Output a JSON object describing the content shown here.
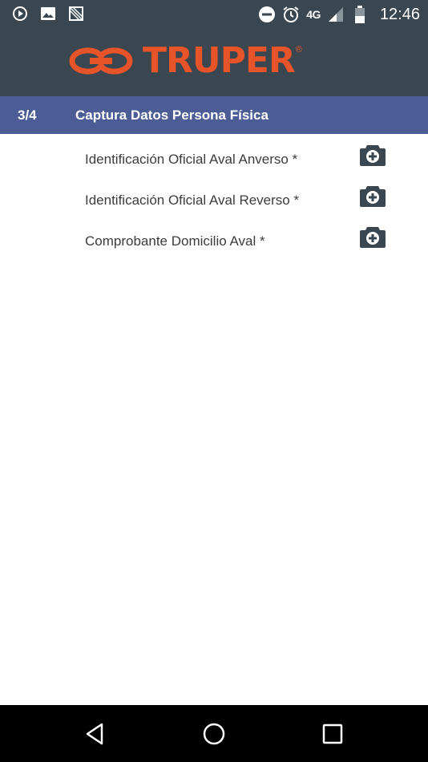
{
  "status_bar": {
    "left_icons": [
      "play-store-icon",
      "image-icon",
      "no-signal-icon"
    ],
    "network": "4G",
    "time": "12:46"
  },
  "header": {
    "brand": "TRUPER",
    "brand_mark": "®",
    "brand_color": "#e8542a"
  },
  "step": {
    "counter": "3/4",
    "title": "Captura Datos Persona Física"
  },
  "documents": [
    {
      "label": "Identificación Oficial Aval Anverso *",
      "action_icon": "camera-add-icon"
    },
    {
      "label": "Identificación Oficial Aval Reverso *",
      "action_icon": "camera-add-icon"
    },
    {
      "label": "Comprobante Domicilio Aval *",
      "action_icon": "camera-add-icon"
    }
  ],
  "colors": {
    "header_bg": "#3a4650",
    "step_bar_bg": "#4c5d96",
    "accent": "#e8542a"
  },
  "nav_bar": {
    "buttons": [
      "back",
      "home",
      "recents"
    ]
  }
}
